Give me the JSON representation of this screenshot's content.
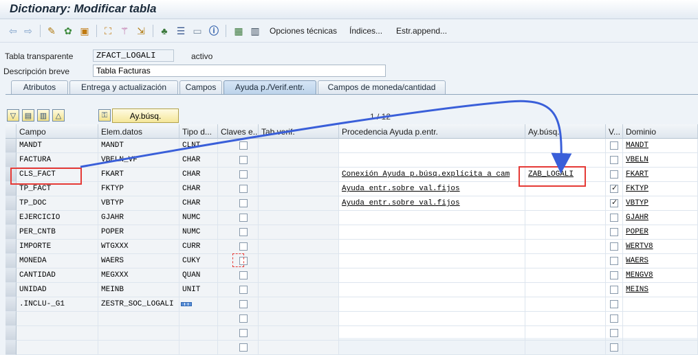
{
  "window": {
    "title": "Dictionary: Modificar tabla"
  },
  "toolbar": {
    "opciones_tecnicas": "Opciones técnicas",
    "indices": "Índices...",
    "estr_append": "Estr.append..."
  },
  "header": {
    "tabla_label": "Tabla transparente",
    "tabla_value": "ZFACT_LOGALI",
    "status": "activo",
    "descripcion_label": "Descripción breve",
    "descripcion_value": "Tabla Facturas"
  },
  "tabs": [
    {
      "label": "Atributos"
    },
    {
      "label": "Entrega y actualización"
    },
    {
      "label": "Campos"
    },
    {
      "label": "Ayuda p./Verif.entr."
    },
    {
      "label": "Campos de moneda/cantidad"
    }
  ],
  "table_toolbar": {
    "ay_busq_button": "Ay.búsq.",
    "pager": "1 / 12"
  },
  "columns": [
    "Campo",
    "Elem.datos",
    "Tipo d...",
    "Claves e...",
    "Tab.verif.",
    "Procedencia Ayuda p.entr.",
    "Ay.búsq.",
    "V...",
    "Dominio"
  ],
  "rows": [
    {
      "campo": "MANDT",
      "elem": "MANDT",
      "tipo": "CLNT",
      "proc": "",
      "aybusq": "",
      "v": false,
      "dominio": "MANDT"
    },
    {
      "campo": "FACTURA",
      "elem": "VBELN_VF",
      "tipo": "CHAR",
      "proc": "",
      "aybusq": "",
      "v": false,
      "dominio": "VBELN"
    },
    {
      "campo": "CLS_FACT",
      "elem": "FKART",
      "tipo": "CHAR",
      "proc": "Conexión Ayuda p.búsq.explícita a cam",
      "aybusq": "ZAB_LOGALI",
      "v": false,
      "dominio": "FKART"
    },
    {
      "campo": "TP_FACT",
      "elem": "FKTYP",
      "tipo": "CHAR",
      "proc": "Ayuda entr.sobre val.fijos",
      "aybusq": "",
      "v": true,
      "dominio": "FKTYP"
    },
    {
      "campo": "TP_DOC",
      "elem": "VBTYP",
      "tipo": "CHAR",
      "proc": "Ayuda entr.sobre val.fijos",
      "aybusq": "",
      "v": true,
      "dominio": "VBTYP"
    },
    {
      "campo": "EJERCICIO",
      "elem": "GJAHR",
      "tipo": "NUMC",
      "proc": "",
      "aybusq": "",
      "v": false,
      "dominio": "GJAHR"
    },
    {
      "campo": "PER_CNTB",
      "elem": "POPER",
      "tipo": "NUMC",
      "proc": "",
      "aybusq": "",
      "v": false,
      "dominio": "POPER"
    },
    {
      "campo": "IMPORTE",
      "elem": "WTGXXX",
      "tipo": "CURR",
      "proc": "",
      "aybusq": "",
      "v": false,
      "dominio": "WERTV8"
    },
    {
      "campo": "MONEDA",
      "elem": "WAERS",
      "tipo": "CUKY",
      "proc": "",
      "aybusq": "",
      "v": false,
      "dominio": "WAERS"
    },
    {
      "campo": "CANTIDAD",
      "elem": "MEGXXX",
      "tipo": "QUAN",
      "proc": "",
      "aybusq": "",
      "v": false,
      "dominio": "MENGV8"
    },
    {
      "campo": "UNIDAD",
      "elem": "MEINB",
      "tipo": "UNIT",
      "proc": "",
      "aybusq": "",
      "v": false,
      "dominio": "MEINS"
    },
    {
      "campo": ".INCLU-_G1",
      "elem": "ZESTR_SOC_LOGALI",
      "tipo": "",
      "proc": "",
      "aybusq": "",
      "v": false,
      "dominio": "",
      "struct_icon": true
    },
    {
      "campo": "",
      "elem": "",
      "tipo": "",
      "proc": "",
      "aybusq": "",
      "v": false,
      "dominio": ""
    },
    {
      "campo": "",
      "elem": "",
      "tipo": "",
      "proc": "",
      "aybusq": "",
      "v": false,
      "dominio": ""
    },
    {
      "campo": "",
      "elem": "",
      "tipo": "",
      "proc": "",
      "aybusq": "",
      "v": false,
      "dominio": ""
    }
  ],
  "colors": {
    "annotation": "#e53935",
    "arrow": "#3a5fd9"
  }
}
